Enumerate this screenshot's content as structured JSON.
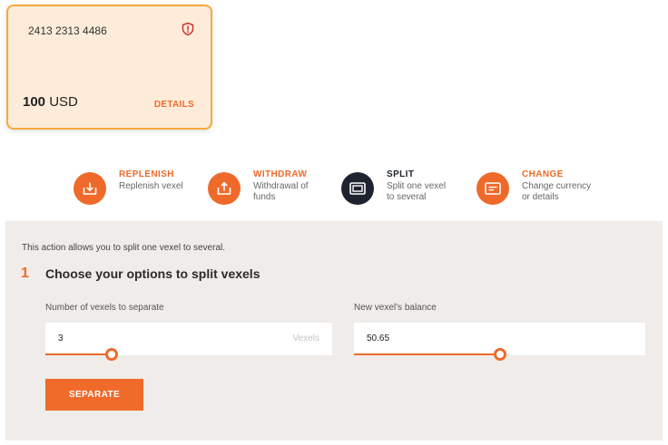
{
  "card": {
    "number": "2413 2313 4486",
    "balance_amount": "100",
    "balance_currency": "USD",
    "details_label": "DETAILS",
    "shield_icon": "shield-alert-icon"
  },
  "actions": [
    {
      "title": "REPLENISH",
      "desc_line1": "Replenish vexel",
      "desc_line2": "",
      "icon": "download-tray-icon"
    },
    {
      "title": "WITHDRAW",
      "desc_line1": "Withdrawal of",
      "desc_line2": "funds",
      "icon": "upload-tray-icon"
    },
    {
      "title": "SPLIT",
      "desc_line1": "Split one vexel",
      "desc_line2": "to several",
      "icon": "split-cards-icon"
    },
    {
      "title": "CHANGE",
      "desc_line1": "Change currency",
      "desc_line2": "or details",
      "icon": "edit-card-icon"
    }
  ],
  "panel": {
    "intro": "This action allows you to split one vexel to several.",
    "step_number": "1",
    "step_title": "Choose your options to split vexels",
    "fields": [
      {
        "label": "Number of vexels to separate",
        "value": "3",
        "unit": "Vexels",
        "slider_fraction": 0.23
      },
      {
        "label": "New vexel's balance",
        "value": "50.65",
        "unit": "",
        "slider_fraction": 0.5
      }
    ],
    "button_label": "SEPARATE"
  },
  "colors": {
    "accent": "#ef6a2a",
    "dark": "#1f2330",
    "card_bg": "#fdecd9",
    "card_border": "#f5a93c",
    "panel_bg": "#efecea"
  }
}
